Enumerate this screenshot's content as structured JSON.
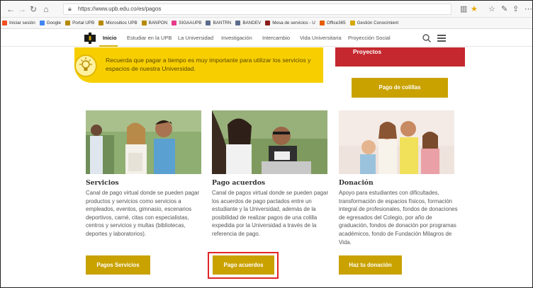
{
  "browser": {
    "url": "https://www.upb.edu.co/es/pagos",
    "bookmarks": [
      {
        "label": "Iniciar sesión",
        "color": "#f25022"
      },
      {
        "label": "Google",
        "color": "#4285f4"
      },
      {
        "label": "Portal UPB",
        "color": "#b68a00"
      },
      {
        "label": "Micrositios UPB",
        "color": "#b68a00"
      },
      {
        "label": "BANPON",
        "color": "#b68a00"
      },
      {
        "label": "SIGAAUPB",
        "color": "#e83a8c"
      },
      {
        "label": "BANTRN",
        "color": "#5b6b8c"
      },
      {
        "label": "BANDEV",
        "color": "#5b6b8c"
      },
      {
        "label": "Mesa de servicios - U",
        "color": "#8a1c1c"
      },
      {
        "label": "Office365",
        "color": "#e65c00"
      },
      {
        "label": "Gestión Conocimient",
        "color": "#d3a800"
      }
    ]
  },
  "nav": {
    "items": [
      {
        "label": "Inicio",
        "active": true
      },
      {
        "label": "Estudiar en la UPB"
      },
      {
        "label": "La Universidad"
      },
      {
        "label": "Investigación"
      },
      {
        "label": "Intercambio"
      },
      {
        "label": "Vida Universitaria"
      },
      {
        "label": "Proyección Social"
      }
    ]
  },
  "notice": {
    "text": "Recuerda que pagar a tiempo es muy importante para utilizar los servicios y espacios de nuestra Universidad."
  },
  "proyectos": {
    "label": "Proyectos"
  },
  "pago_colillas": {
    "label": "Pago de colillas"
  },
  "cards": [
    {
      "title": "Servicios",
      "description": "Canal de pago virtual donde se pueden pagar productos y servicios como servicios a empleados, eventos, gimnasio, escenarios deportivos, carné, citas con especialistas, centros y servicios y multas (bibliotecas, deportes y laboratorios).",
      "button": "Pagos Servicios"
    },
    {
      "title": "Pago acuerdos",
      "description": "Canal de pagos virtual donde se pueden pagar los acuerdos de pago pactados entre un estudiante y la Universidad, además de la posibilidad de realizar pagos de una colilla expedida por la Universidad a través de la referencia de pago.",
      "button": "Pago acuerdos"
    },
    {
      "title": "Donación",
      "description": "Apoyo para estudiantes con dificultades, transformación de espacios físicos, formación integral de profesionales, fondos de donaciones de egresados del Colegio, por año de graduación, fondos de donación por programas académicos, fondo de Fundación Milagros de Vida.",
      "button": "Haz tu donación"
    }
  ],
  "colors": {
    "accent_gold": "#c9a200",
    "notice_yellow": "#f7cf00",
    "proyectos_red": "#c5282f",
    "highlight_red": "#e02525"
  }
}
